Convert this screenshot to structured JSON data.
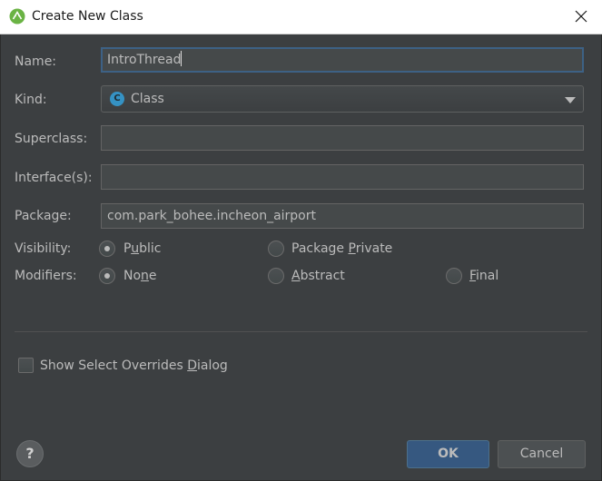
{
  "window": {
    "title": "Create New Class",
    "app_icon": "android-studio-icon",
    "close_icon": "close-icon"
  },
  "form": {
    "name": {
      "label": "Name:",
      "value": "IntroThread"
    },
    "kind": {
      "label": "Kind:",
      "value": "Class",
      "icon_letter": "C",
      "icon": "class-icon"
    },
    "superclass": {
      "label": "Superclass:",
      "value": ""
    },
    "interfaces": {
      "label": "Interface(s):",
      "value": ""
    },
    "package": {
      "label": "Package:",
      "value": "com.park_bohee.incheon_airport"
    },
    "visibility": {
      "label": "Visibility:",
      "options": [
        {
          "pre": "P",
          "mnemonic": "u",
          "post": "blic",
          "checked": true
        },
        {
          "pre": "Package ",
          "mnemonic": "P",
          "post": "rivate",
          "checked": false
        }
      ]
    },
    "modifiers": {
      "label": "Modifiers:",
      "options": [
        {
          "pre": "No",
          "mnemonic": "n",
          "post": "e",
          "checked": true
        },
        {
          "pre": "",
          "mnemonic": "A",
          "post": "bstract",
          "checked": false
        },
        {
          "pre": "",
          "mnemonic": "F",
          "post": "inal",
          "checked": false
        }
      ]
    },
    "show_overrides": {
      "pre": "Show Select Overrides ",
      "mnemonic": "D",
      "post": "ialog",
      "checked": false
    }
  },
  "footer": {
    "help_label": "?",
    "ok_label": "OK",
    "cancel_label": "Cancel"
  },
  "colors": {
    "background": "#3c3f41",
    "ok_button": "#365880",
    "focus_border": "#3d6185",
    "class_icon": "#3592c4"
  }
}
